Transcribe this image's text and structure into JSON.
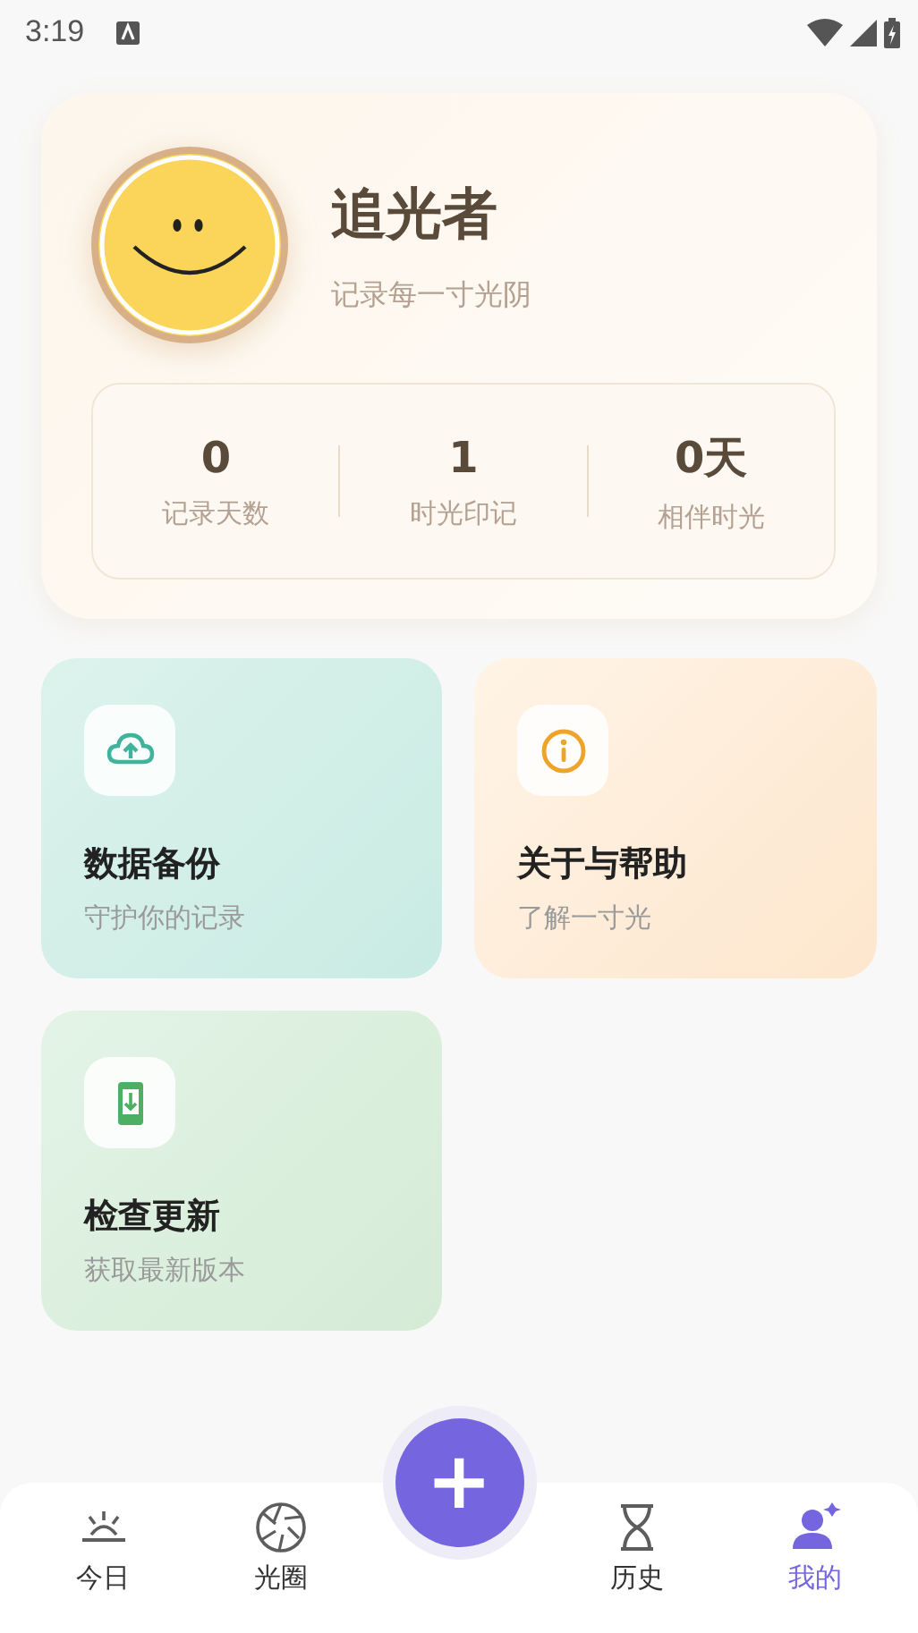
{
  "status_bar": {
    "time": "3:19"
  },
  "profile": {
    "name": "追光者",
    "motto": "记录每一寸光阴",
    "stats": [
      {
        "value": "0",
        "label": "记录天数"
      },
      {
        "value": "1",
        "label": "时光印记"
      },
      {
        "value": "0天",
        "label": "相伴时光"
      }
    ]
  },
  "tiles": [
    {
      "kind": "backup",
      "title": "数据备份",
      "subtitle": "守护你的记录"
    },
    {
      "kind": "about",
      "title": "关于与帮助",
      "subtitle": "了解一寸光"
    },
    {
      "kind": "update",
      "title": "检查更新",
      "subtitle": "获取最新版本"
    }
  ],
  "fab": {
    "label": "+"
  },
  "tabs": [
    {
      "kind": "today",
      "label": "今日",
      "selected": false
    },
    {
      "kind": "aperture",
      "label": "光圈",
      "selected": false
    },
    {
      "kind": "history",
      "label": "历史",
      "selected": false
    },
    {
      "kind": "mine",
      "label": "我的",
      "selected": true
    }
  ]
}
